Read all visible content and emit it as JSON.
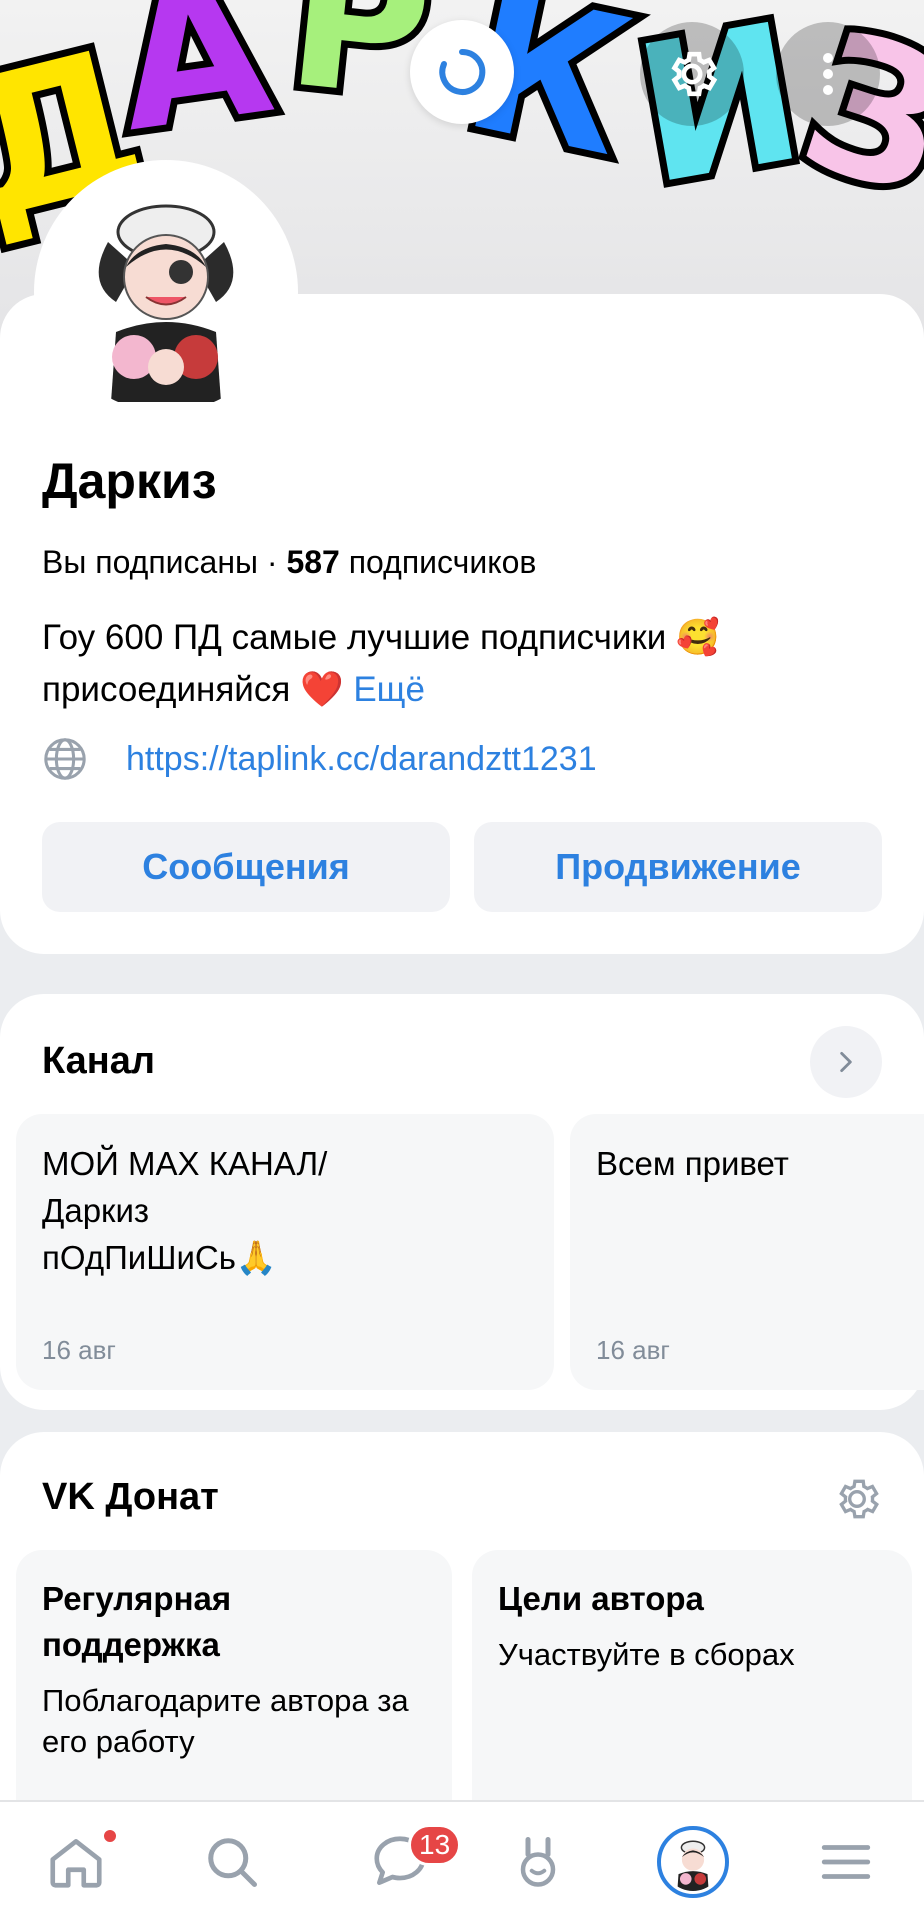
{
  "profile": {
    "name": "Даркиз",
    "subscribed_text": "Вы подписаны · ",
    "subscribers_count": "587",
    "subscribers_label": " подписчиков",
    "status_text": "Гоу 600 ПД самые лучшие подписчики 🥰 присоединяйся ❤️",
    "more_label": "Ещё",
    "link": "https://taplink.cc/darandztt1231",
    "messages_button": "Сообщения",
    "promotion_button": "Продвижение"
  },
  "channel": {
    "title": "Канал",
    "posts": [
      {
        "text": "МОЙ МАХ КАНАЛ/Даркиз пОдПиШиСь🙏",
        "date": "16 авг"
      },
      {
        "text": "Всем привет",
        "date": "16 авг"
      }
    ]
  },
  "donat": {
    "title": "VK Донат",
    "tiles": [
      {
        "title": "Регулярная поддержка",
        "text": "Поблагодарите автора за его работу"
      },
      {
        "title": "Цели автора",
        "text": "Участвуйте в сборах"
      }
    ]
  },
  "tabbar": {
    "messages_badge": "13"
  },
  "colors": {
    "accent": "#2d81e0",
    "badge": "#e64646"
  }
}
